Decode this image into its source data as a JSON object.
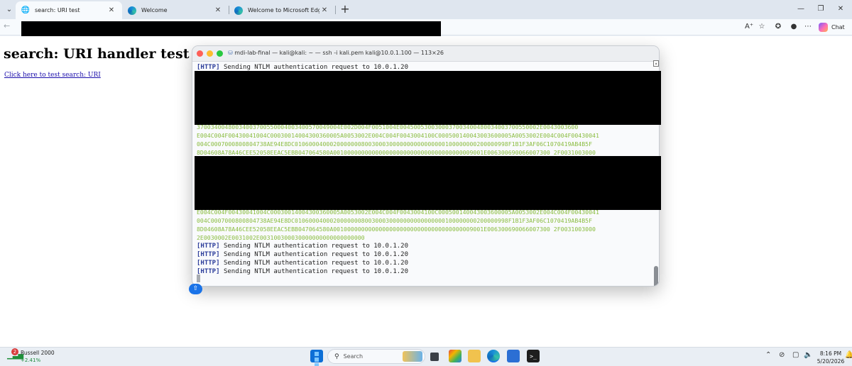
{
  "browser": {
    "tabs": [
      {
        "label": "search: URI test",
        "active": true
      },
      {
        "label": "Welcome",
        "active": false
      },
      {
        "label": "Welcome to Microsoft Edge",
        "active": false
      }
    ],
    "chat_label": "Chat"
  },
  "page": {
    "heading": "search: URI handler test",
    "link_text": "Click here to test search: URI"
  },
  "terminal": {
    "title": "mdi-lab-final — kali@kali: ~ — ssh -i kali.pem kali@10.0.1.100 — 113×26",
    "tag": "[HTTP]",
    "message": "Sending NTLM authentication request to 10.0.1.20",
    "hex_block_1": [
      "37003400480034003700550004003400570049004E002D004F0051004E0045005300300037003400480034003700550002E0043003600",
      "E004C004F00430041004C00030014004300360005A0053002E004C004F0043004100C000500140043003600005A0053002E004C004F00430041",
      "004C0007000800804738AE94E8DC0106000400020000000800300030000000000000000100000000200000998F1B1F3AF06C1070419AB4B5F",
      "8D04608A78A46CEE52058EEAC5EBB047064580A0010000000000000000000000000000000000009001E006300690066007300 2F0031003000"
    ],
    "hex_block_2": [
      "E004C004F00430041004C00030014004300360005A0053002E004C004F0043004100C000500140043003600005A0053002E004C004F00430041",
      "004C0007000800804738AE94E8DC0106000400020000000800300030000000000000000100000000200000998F1B1F3AF06C1070419AB4B5F",
      "8D04608A78A46CEE52058EEAC5EBB047064580A0010000000000000000000000000000000000009001E006300690066007300 2F0031003000",
      "2E0030002E0031002E003100300030000000000000000000"
    ]
  },
  "taskbar": {
    "widget_badge": "2",
    "widget_title": "Russell 2000",
    "widget_change": "+2.41%",
    "search_placeholder": "Search",
    "time": "8:16 PM",
    "date": "5/20/2026"
  },
  "colors": {
    "terminal_tag": "#2d3e9b",
    "terminal_hex": "#8bbd41",
    "link": "#1a0dab",
    "accent": "#1a73e8"
  }
}
